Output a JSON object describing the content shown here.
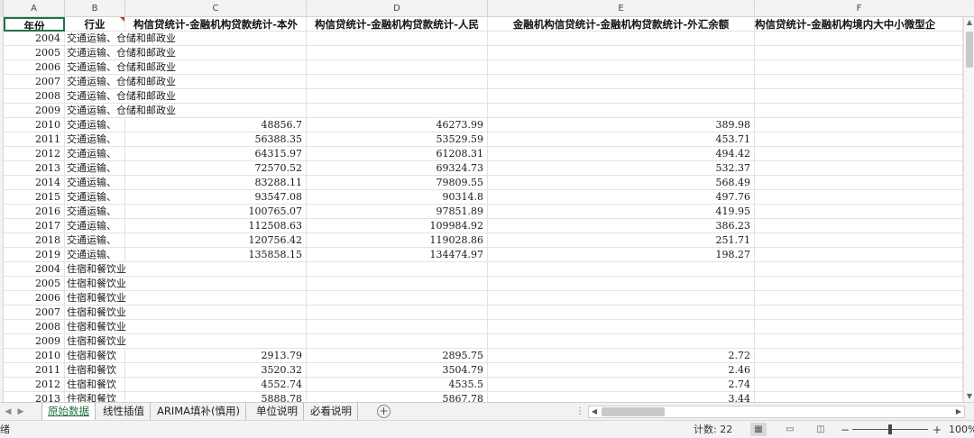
{
  "columns": [
    "A",
    "B",
    "C",
    "D",
    "E",
    "F"
  ],
  "header_row": {
    "year": "年份",
    "industry": "行业",
    "c": "构信贷统计-金融机构贷款统计-本外",
    "d": "构信贷统计-金融机构贷款统计-人民",
    "e": "金融机构信贷统计-金融机构贷款统计-外汇余额",
    "f": "构信贷统计-金融机构境内大中小微型企"
  },
  "rows": [
    [
      "2004",
      "交通运输、仓储和邮政业",
      "",
      "",
      ""
    ],
    [
      "2005",
      "交通运输、仓储和邮政业",
      "",
      "",
      ""
    ],
    [
      "2006",
      "交通运输、仓储和邮政业",
      "",
      "",
      ""
    ],
    [
      "2007",
      "交通运输、仓储和邮政业",
      "",
      "",
      ""
    ],
    [
      "2008",
      "交通运输、仓储和邮政业",
      "",
      "",
      ""
    ],
    [
      "2009",
      "交通运输、仓储和邮政业",
      "",
      "",
      ""
    ],
    [
      "2010",
      "交通运输、",
      "48856.7",
      "46273.99",
      "389.98"
    ],
    [
      "2011",
      "交通运输、",
      "56388.35",
      "53529.59",
      "453.71"
    ],
    [
      "2012",
      "交通运输、",
      "64315.97",
      "61208.31",
      "494.42"
    ],
    [
      "2013",
      "交通运输、",
      "72570.52",
      "69324.73",
      "532.37"
    ],
    [
      "2014",
      "交通运输、",
      "83288.11",
      "79809.55",
      "568.49"
    ],
    [
      "2015",
      "交通运输、",
      "93547.08",
      "90314.8",
      "497.76"
    ],
    [
      "2016",
      "交通运输、",
      "100765.07",
      "97851.89",
      "419.95"
    ],
    [
      "2017",
      "交通运输、",
      "112508.63",
      "109984.92",
      "386.23"
    ],
    [
      "2018",
      "交通运输、",
      "120756.42",
      "119028.86",
      "251.71"
    ],
    [
      "2019",
      "交通运输、",
      "135858.15",
      "134474.97",
      "198.27"
    ],
    [
      "2004",
      "住宿和餐饮业",
      "",
      "",
      ""
    ],
    [
      "2005",
      "住宿和餐饮业",
      "",
      "",
      ""
    ],
    [
      "2006",
      "住宿和餐饮业",
      "",
      "",
      ""
    ],
    [
      "2007",
      "住宿和餐饮业",
      "",
      "",
      ""
    ],
    [
      "2008",
      "住宿和餐饮业",
      "",
      "",
      ""
    ],
    [
      "2009",
      "住宿和餐饮业",
      "",
      "",
      ""
    ],
    [
      "2010",
      "住宿和餐饮",
      "2913.79",
      "2895.75",
      "2.72"
    ],
    [
      "2011",
      "住宿和餐饮",
      "3520.32",
      "3504.79",
      "2.46"
    ],
    [
      "2012",
      "住宿和餐饮",
      "4552.74",
      "4535.5",
      "2.74"
    ],
    [
      "2013",
      "住宿和餐饮",
      "5888.78",
      "5867.78",
      "3.44"
    ]
  ],
  "tabs": [
    "原始数据",
    "线性插值",
    "ARIMA填补(慎用)",
    "单位说明",
    "必看说明"
  ],
  "active_tab": 0,
  "status": {
    "left": "绪",
    "count": "计数: 22",
    "zoom": "100%",
    "zoom_minus": "−",
    "zoom_plus": "+"
  },
  "accent_color": "#217346"
}
